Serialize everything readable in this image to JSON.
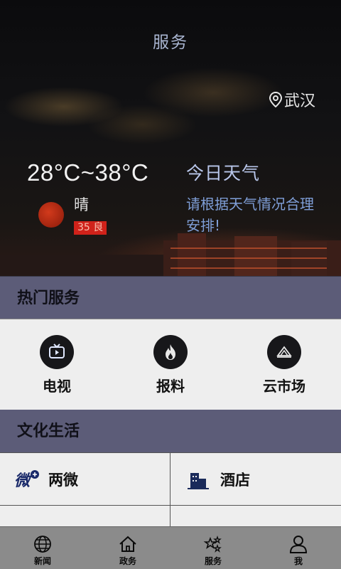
{
  "header": {
    "title": "服务"
  },
  "weather": {
    "location": "武汉",
    "temperature_range": "28°C~38°C",
    "condition": "晴",
    "aqi": "35 良",
    "today_title": "今日天气",
    "today_tip": "请根据天气情况合理安排!"
  },
  "hot_services": {
    "title": "热门服务",
    "items": [
      {
        "label": "电视",
        "icon": "tv-icon"
      },
      {
        "label": "报料",
        "icon": "fire-icon"
      },
      {
        "label": "云市场",
        "icon": "cloud-market-icon"
      }
    ]
  },
  "culture": {
    "title": "文化生活",
    "items": [
      {
        "label": "两微",
        "icon": "weibo-weixin-icon"
      },
      {
        "label": "酒店",
        "icon": "hotel-icon"
      },
      {
        "label": "",
        "icon": "partial-icon"
      },
      {
        "label": "",
        "icon": "partial-icon"
      }
    ]
  },
  "bottom_nav": {
    "items": [
      {
        "label": "新闻",
        "icon": "globe-icon"
      },
      {
        "label": "政务",
        "icon": "home-icon"
      },
      {
        "label": "服务",
        "icon": "stars-icon"
      },
      {
        "label": "我",
        "icon": "user-icon"
      }
    ]
  },
  "colors": {
    "section_header": "#5c5c78",
    "aqi_badge": "#d0221a",
    "title_blue": "#aab6d2",
    "tip_blue": "#7f9fd8",
    "nav_bg": "#8b8b8b"
  }
}
